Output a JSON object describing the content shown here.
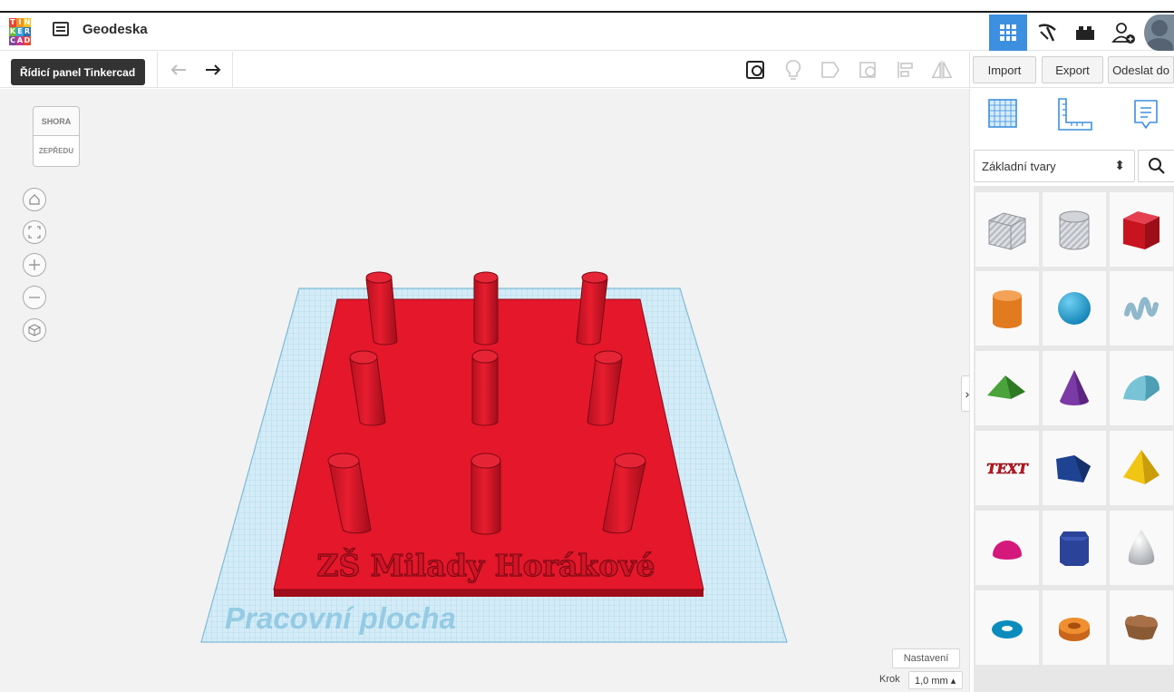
{
  "header": {
    "logo_letters": [
      "T",
      "I",
      "N",
      "K",
      "E",
      "R",
      "C",
      "A",
      "D"
    ],
    "title": "Geodeska",
    "tooltip": "Řídicí panel Tinkercad"
  },
  "toolbar": {
    "import_label": "Import",
    "export_label": "Export",
    "send_label": "Odeslat do"
  },
  "viewcube": {
    "top_label": "SHORA",
    "front_label": "ZEPŘEDU"
  },
  "workplane": {
    "label": "Pracovní plocha",
    "engraved_text": "ZŠ Milady Horákové"
  },
  "footer": {
    "settings_label": "Nastavení",
    "step_label": "Krok",
    "step_value": "1,0 mm ▴"
  },
  "sidebar": {
    "category": "Základní tvary",
    "shapes": [
      "box-hole",
      "cylinder-hole",
      "box",
      "cylinder",
      "sphere",
      "scribble",
      "roof",
      "cone",
      "round-roof",
      "text",
      "half-cylinder",
      "pyramid",
      "half-sphere",
      "polygon",
      "paraboloid",
      "torus",
      "tube",
      "heart"
    ]
  },
  "colors": {
    "accent": "#3d8fe0",
    "model_red": "#e4172b",
    "workplane": "#c8e6f5"
  }
}
